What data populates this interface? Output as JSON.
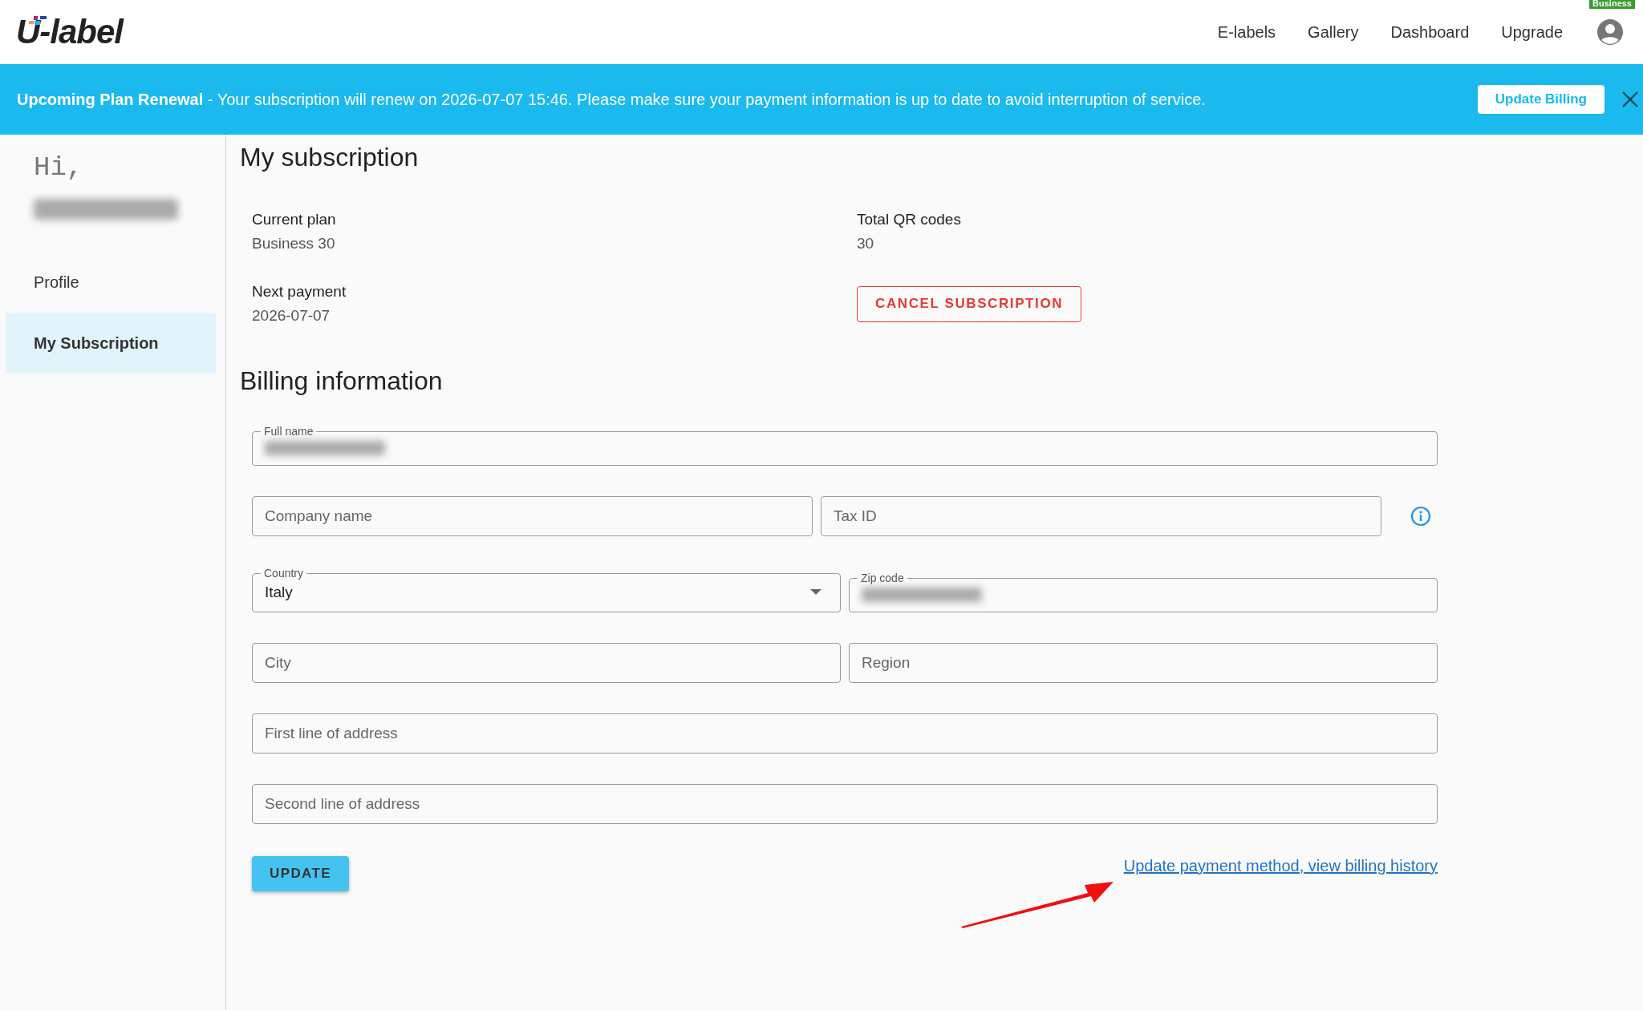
{
  "header": {
    "logo": "U-label",
    "nav": [
      "E-labels",
      "Gallery",
      "Dashboard",
      "Upgrade"
    ],
    "plan_badge": "Business"
  },
  "banner": {
    "title": "Upcoming Plan Renewal",
    "message": " - Your subscription will renew on 2026-07-07 15:46. Please make sure your payment information is up to date to avoid interruption of service.",
    "button": "Update Billing"
  },
  "sidebar": {
    "greeting": "Hi,",
    "name_blurred": true,
    "items": [
      {
        "label": "Profile",
        "selected": false
      },
      {
        "label": "My Subscription",
        "selected": true
      }
    ]
  },
  "subscription": {
    "title": "My subscription",
    "facts": [
      {
        "label": "Current plan",
        "value": "Business 30"
      },
      {
        "label": "Total QR codes",
        "value": "30"
      },
      {
        "label": "Next payment",
        "value": "2026-07-07"
      }
    ],
    "cancel_button": "CANCEL SUBSCRIPTION"
  },
  "billing": {
    "title": "Billing information",
    "rows": [
      [
        {
          "kind": "text",
          "label": "Full name",
          "blurred": true
        }
      ],
      [
        {
          "kind": "text",
          "placeholder": "Company name"
        },
        {
          "kind": "text",
          "placeholder": "Tax ID",
          "info": true
        }
      ],
      [
        {
          "kind": "select",
          "label": "Country",
          "value": "Italy"
        },
        {
          "kind": "text",
          "label": "Zip code",
          "blurred": true
        }
      ],
      [
        {
          "kind": "text",
          "placeholder": "City"
        },
        {
          "kind": "text",
          "placeholder": "Region"
        }
      ],
      [
        {
          "kind": "text",
          "placeholder": "First line of address"
        }
      ],
      [
        {
          "kind": "text",
          "placeholder": "Second line of address"
        }
      ]
    ],
    "update_button": "UPDATE",
    "link": "Update payment method, view billing history"
  }
}
